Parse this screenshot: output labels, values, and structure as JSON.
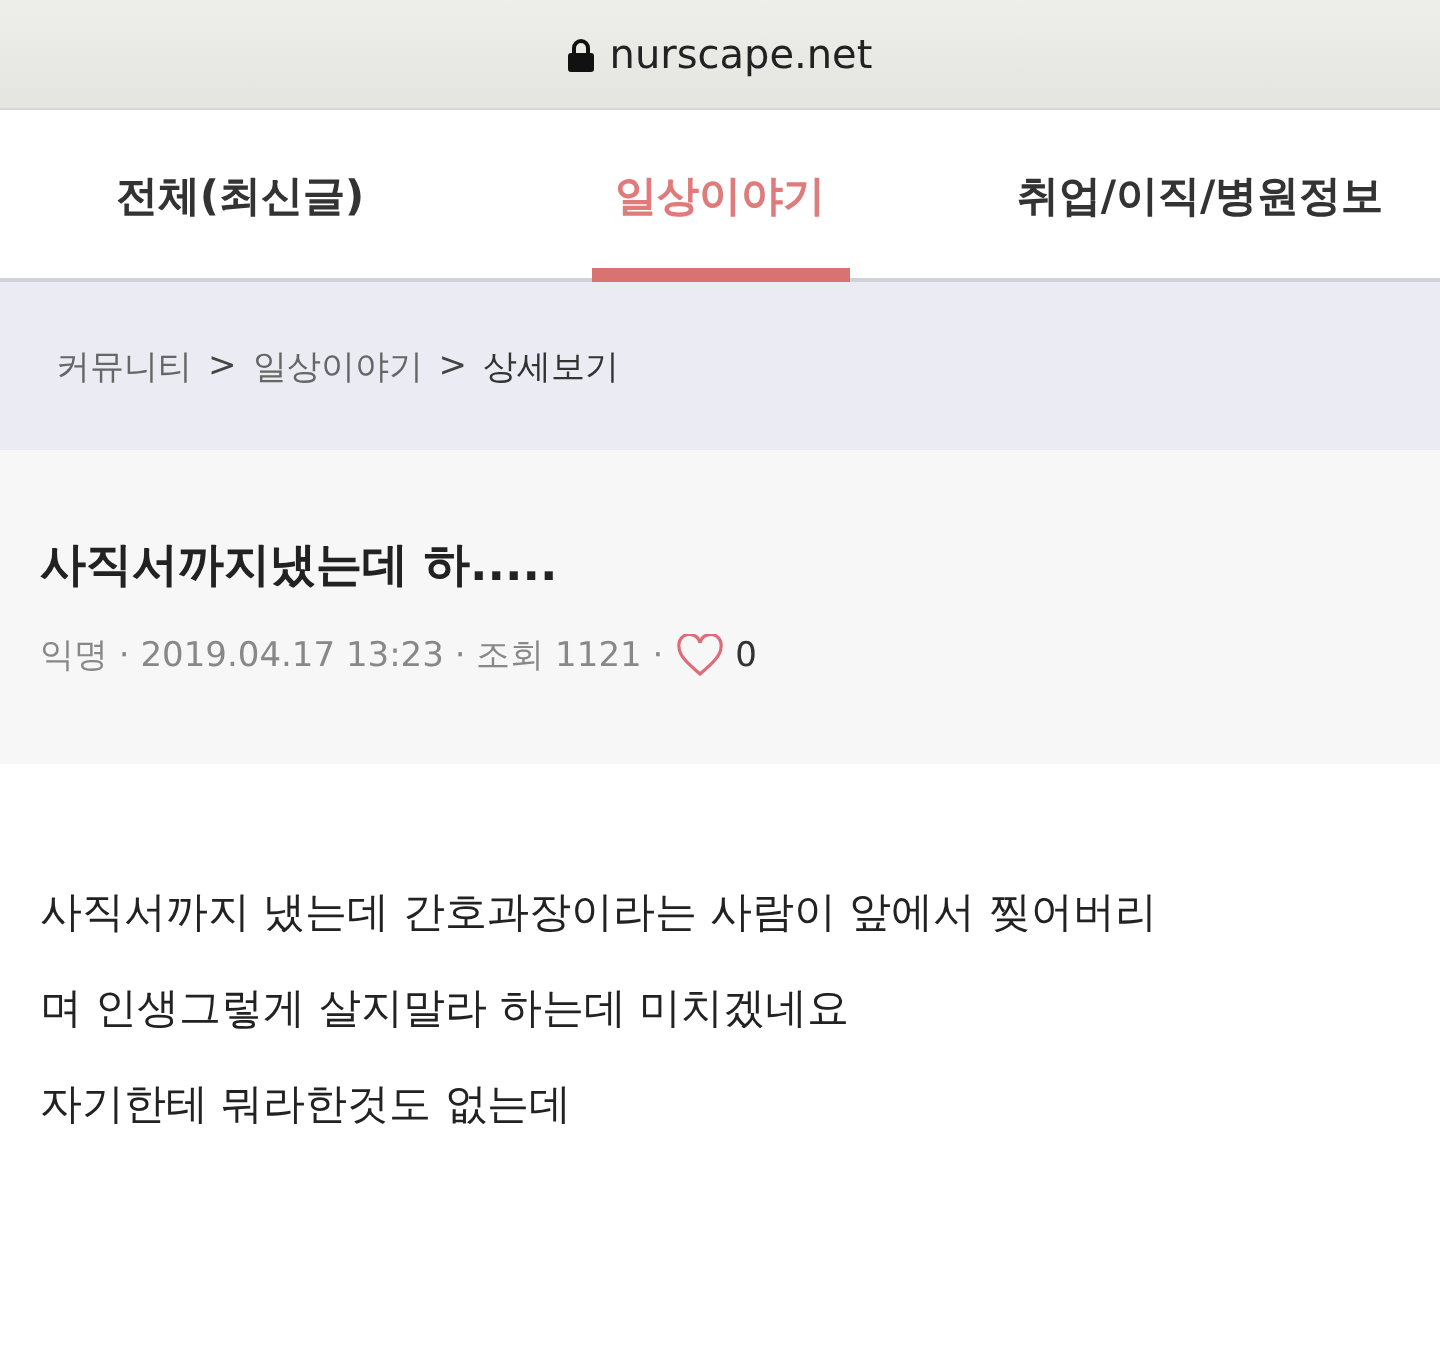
{
  "address_bar": {
    "url": "nurscape.net",
    "secure": true
  },
  "tabs": [
    {
      "label": "전체(최신글)",
      "selected": false
    },
    {
      "label": "일상이야기",
      "selected": true
    },
    {
      "label": "취업/이직/병원정보",
      "selected": false
    }
  ],
  "breadcrumb": [
    {
      "text": "커뮤니티",
      "kind": "link"
    },
    {
      "text": ">",
      "kind": "separator"
    },
    {
      "text": "일상이야기",
      "kind": "link"
    },
    {
      "text": ">",
      "kind": "separator"
    },
    {
      "text": "상세보기",
      "kind": "current"
    }
  ],
  "post": {
    "title": "사직서까지냈는데 하.....",
    "meta": "익명 · 2019.04.17 13:23 · 조회 1121 ·",
    "liked": false,
    "likes": "0",
    "body_lines": [
      "사직서까지 냈는데 간호과장이라는 사람이 앞에서 찢어버리",
      "며 인생그렇게 살지말라 하는데 미치겠네요",
      "자기한테 뭐라한것도 없는데"
    ]
  }
}
